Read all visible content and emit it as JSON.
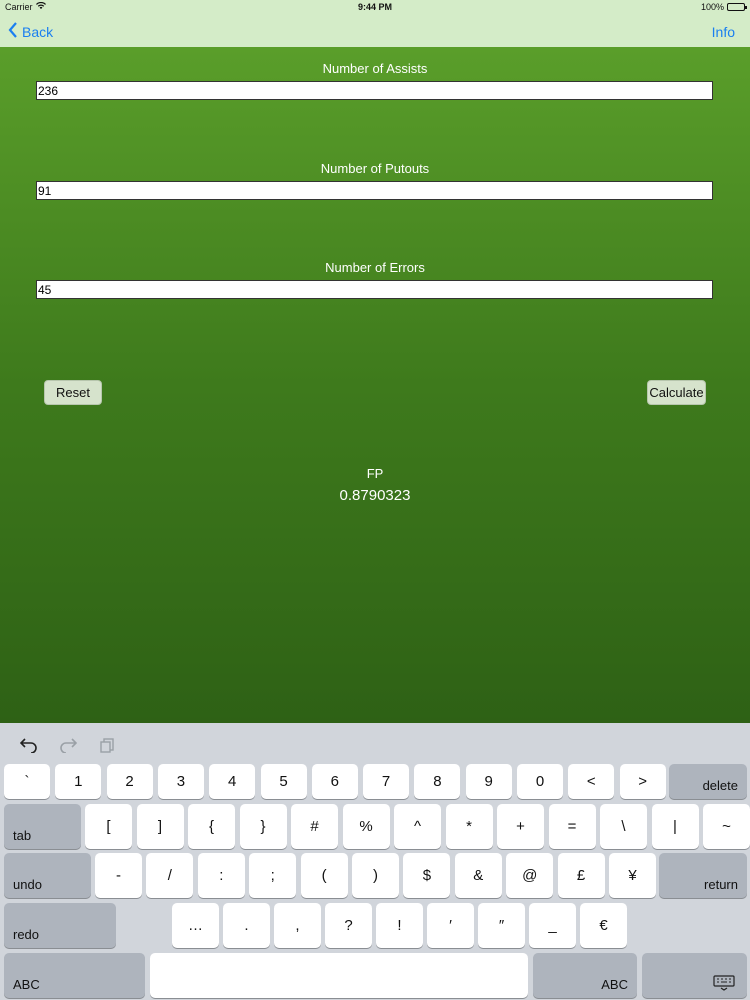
{
  "status_bar": {
    "carrier": "Carrier",
    "time": "9:44 PM",
    "battery": "100%"
  },
  "nav": {
    "back_label": "Back",
    "info_label": "Info"
  },
  "form": {
    "assists_label": "Number of Assists",
    "assists_value": "236",
    "putouts_label": "Number of Putouts",
    "putouts_value": "91",
    "errors_label": "Number of Errors",
    "errors_value": "45"
  },
  "buttons": {
    "reset": "Reset",
    "calculate": "Calculate"
  },
  "result": {
    "label": "FP",
    "value": "0.8790323"
  },
  "keyboard": {
    "toolbar_icons": [
      "undo-icon",
      "redo-icon",
      "paste-icon"
    ],
    "row1": [
      "`",
      "1",
      "2",
      "3",
      "4",
      "5",
      "6",
      "7",
      "8",
      "9",
      "0",
      "<",
      ">"
    ],
    "row1_special": "delete",
    "row2_special": "tab",
    "row2": [
      "[",
      "]",
      "{",
      "}",
      "#",
      "%",
      "^",
      "*",
      "+",
      "=",
      "\\",
      "|",
      "~"
    ],
    "row3_special": "undo",
    "row3": [
      "-",
      "/",
      ":",
      ";",
      "(",
      ")",
      "$",
      "&",
      "@",
      "£",
      "¥"
    ],
    "row3_special_right": "return",
    "row4_special": "redo",
    "row4": [
      "…",
      ".",
      ",",
      "?",
      "!",
      "′",
      "″",
      "_",
      "€"
    ],
    "row5_left": "ABC",
    "row5_right": "ABC",
    "dismiss_icon": "keyboard-dismiss-icon"
  }
}
